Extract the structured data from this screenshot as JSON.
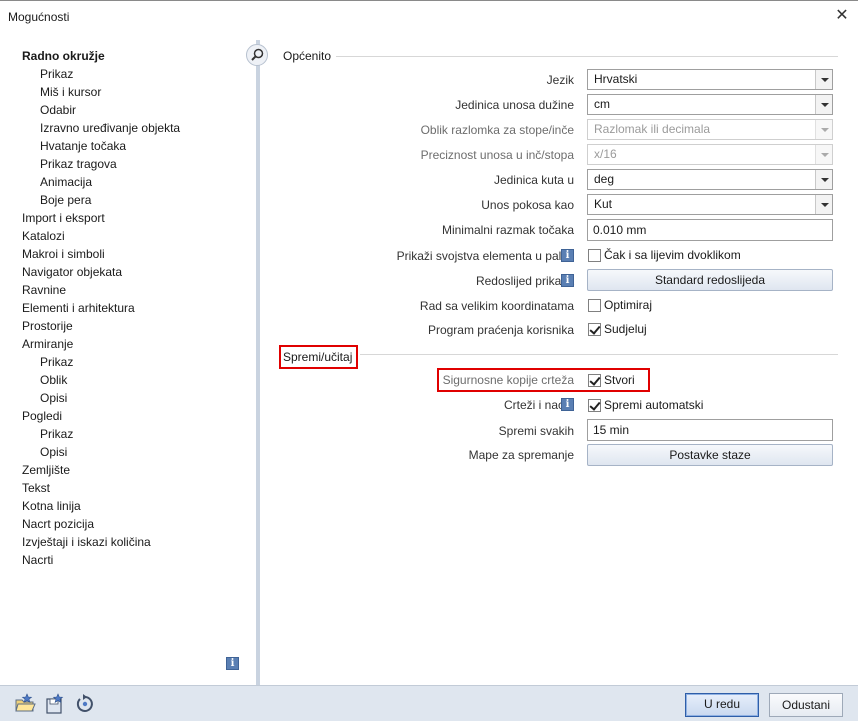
{
  "window": {
    "title": "Mogućnosti",
    "close_label": "✕"
  },
  "tree": [
    {
      "label": "Radno okružje",
      "level": 0,
      "selected": true
    },
    {
      "label": "Prikaz",
      "level": 1
    },
    {
      "label": "Miš i kursor",
      "level": 1
    },
    {
      "label": "Odabir",
      "level": 1
    },
    {
      "label": "Izravno uređivanje objekta",
      "level": 1
    },
    {
      "label": "Hvatanje točaka",
      "level": 1
    },
    {
      "label": "Prikaz tragova",
      "level": 1
    },
    {
      "label": "Animacija",
      "level": 1
    },
    {
      "label": "Boje pera",
      "level": 1
    },
    {
      "label": "Import i eksport",
      "level": 0
    },
    {
      "label": "Katalozi",
      "level": 0
    },
    {
      "label": "Makroi i simboli",
      "level": 0
    },
    {
      "label": "Navigator objekata",
      "level": 0
    },
    {
      "label": "Ravnine",
      "level": 0
    },
    {
      "label": "Elementi i arhitektura",
      "level": 0
    },
    {
      "label": "Prostorije",
      "level": 0
    },
    {
      "label": "Armiranje",
      "level": 0
    },
    {
      "label": "Prikaz",
      "level": 1
    },
    {
      "label": "Oblik",
      "level": 1
    },
    {
      "label": "Opisi",
      "level": 1
    },
    {
      "label": "Pogledi",
      "level": 0
    },
    {
      "label": "Prikaz",
      "level": 1
    },
    {
      "label": "Opisi",
      "level": 1
    },
    {
      "label": "Zemljište",
      "level": 0
    },
    {
      "label": "Tekst",
      "level": 0
    },
    {
      "label": "Kotna linija",
      "level": 0
    },
    {
      "label": "Nacrt pozicija",
      "level": 0
    },
    {
      "label": "Izvještaji i iskazi količina",
      "level": 0
    },
    {
      "label": "Nacrti",
      "level": 0
    }
  ],
  "general": {
    "heading": "Općenito",
    "language": {
      "label": "Jezik",
      "value": "Hrvatski"
    },
    "length_unit": {
      "label": "Jedinica unosa dužine",
      "value": "cm"
    },
    "fraction_format": {
      "label": "Oblik razlomka za stope/inče",
      "value": "Razlomak ili decimala"
    },
    "inch_precision": {
      "label": "Preciznost unosa u inč/stopa",
      "value": "x/16"
    },
    "angle_unit": {
      "label": "Jedinica kuta u",
      "value": "deg"
    },
    "slope_input": {
      "label": "Unos pokosa kao",
      "value": "Kut"
    },
    "min_point_distance": {
      "label": "Minimalni razmak točaka",
      "value": "0.010 mm"
    },
    "show_properties": {
      "label": "Prikaži  svojstva elementa u paleti",
      "checkbox_label": "Čak i sa lijevim dvoklikom",
      "checked": false
    },
    "display_order": {
      "label": "Redoslijed prikaza",
      "button_label": "Standard redoslijeda"
    },
    "large_coords": {
      "label": "Rad sa velikim koordinatama",
      "checkbox_label": "Optimiraj",
      "checked": false
    },
    "user_tracking": {
      "label": "Program praćenja korisnika",
      "checkbox_label": "Sudjeluj",
      "checked": true
    }
  },
  "save_load": {
    "heading": "Spremi/učitaj",
    "backups": {
      "label": "Sigurnosne kopije crteža",
      "checkbox_label": "Stvori",
      "checked": true
    },
    "drawings": {
      "label": "Crteži i nacrti",
      "checkbox_label": "Spremi automatski",
      "checked": true
    },
    "save_every": {
      "label": "Spremi svakih",
      "value": "15 min"
    },
    "save_folders": {
      "label": "Mape za spremanje",
      "button_label": "Postavke staze"
    }
  },
  "footer": {
    "ok_label": "U redu",
    "cancel_label": "Odustani"
  },
  "colors": {
    "highlight": "#e00000",
    "accent": "#2f5ea8"
  },
  "icons": [
    "search-icon",
    "info-icon",
    "open-favorites-icon",
    "save-favorites-icon",
    "reset-icon",
    "close-icon"
  ]
}
